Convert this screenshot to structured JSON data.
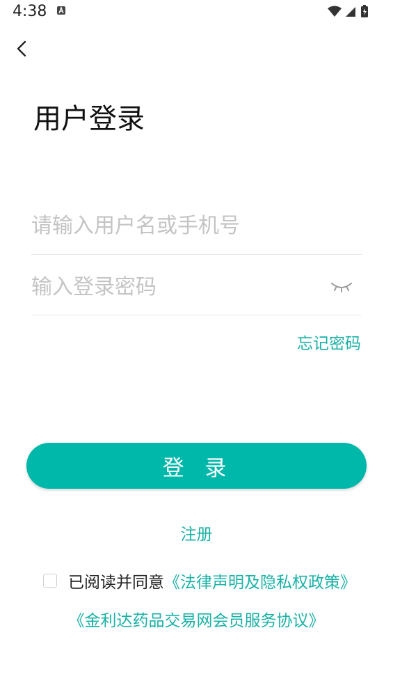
{
  "status_bar": {
    "time": "4:38",
    "notification_icon": "accessibility-notification-icon",
    "wifi_icon": "wifi-icon",
    "signal_icon": "signal-icon",
    "battery_icon": "battery-charging-icon"
  },
  "header": {
    "back_icon": "chevron-left-icon",
    "title": "用户登录"
  },
  "form": {
    "username_placeholder": "请输入用户名或手机号",
    "password_placeholder": "输入登录密码",
    "eye_icon": "eye-closed-icon",
    "forgot_password": "忘记密码"
  },
  "actions": {
    "login_label": "登 录",
    "register_label": "注册"
  },
  "agreement": {
    "prefix": "已阅读并同意",
    "policy_link": "《法律声明及隐私权政策》",
    "service_link": "《金利达药品交易网会员服务协议》"
  },
  "colors": {
    "accent": "#00b8aa",
    "link": "#19b2a6"
  }
}
